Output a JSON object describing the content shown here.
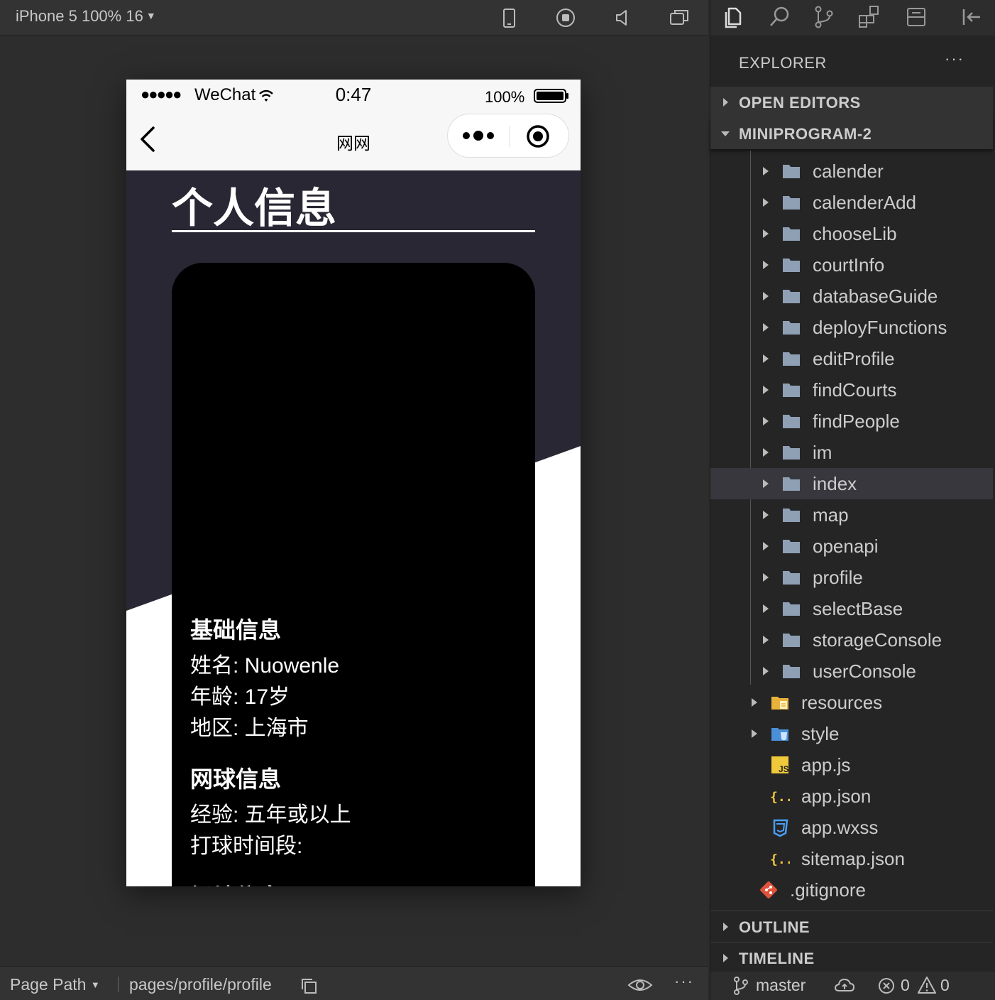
{
  "toolbar": {
    "device": "iPhone 5 100% 16",
    "icons": [
      "phone-icon",
      "record-icon",
      "volume-icon",
      "window-icon"
    ]
  },
  "phone": {
    "status": {
      "signal": "●●●●●",
      "carrier": "WeChat",
      "time": "0:47",
      "battery": "100%"
    },
    "nav": {
      "title": "网网"
    },
    "page": {
      "title": "个人信息",
      "basic": {
        "title": "基础信息",
        "lines": [
          "姓名: Nuowenle",
          "年龄: 17岁",
          "地区: 上海市"
        ]
      },
      "tennis": {
        "title": "网球信息",
        "lines": [
          "经验: 五年或以上",
          "打球时间段:"
        ]
      },
      "court": {
        "title": "场地信息"
      }
    },
    "colors": {
      "dark_bg": "#292733",
      "card": "#000000"
    }
  },
  "bottom_bar": {
    "page_path_label": "Page Path",
    "page_path": "pages/profile/profile",
    "more": "···"
  },
  "explorer": {
    "title": "EXPLORER",
    "more": "···",
    "sections": {
      "open_editors": "OPEN EDITORS",
      "project": "MINIPROGRAM-2",
      "outline": "OUTLINE",
      "timeline": "TIMELINE"
    },
    "folders": [
      "calender",
      "calenderAdd",
      "chooseLib",
      "courtInfo",
      "databaseGuide",
      "deployFunctions",
      "editProfile",
      "findCourts",
      "findPeople",
      "im",
      "index",
      "map",
      "openapi",
      "profile",
      "selectBase",
      "storageConsole",
      "userConsole"
    ],
    "selected_folder": "index",
    "root_items": {
      "resources": "resources",
      "style": "style",
      "app_js": "app.js",
      "app_json": "app.json",
      "app_wxss": "app.wxss",
      "sitemap": "sitemap.json",
      "gitignore": ".gitignore"
    },
    "status": {
      "branch": "master",
      "errors": "0",
      "warnings": "0"
    }
  }
}
